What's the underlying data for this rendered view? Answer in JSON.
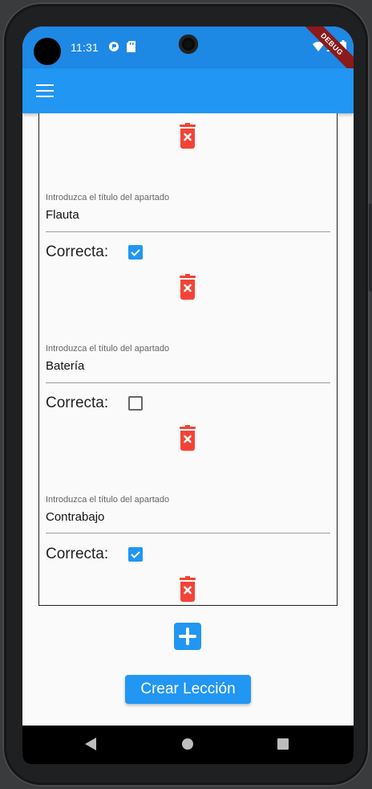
{
  "status_bar": {
    "time": "11:31",
    "icons": [
      "camera-hole",
      "p-badge-icon",
      "sd-card-icon",
      "wifi-icon",
      "signal-icon",
      "battery-icon"
    ],
    "debug_banner": "DEBUG"
  },
  "app_bar": {
    "menu_icon": "menu-icon"
  },
  "options": [
    {
      "label": "Introduzca el título del apartado",
      "value": "Flauta",
      "correct_label": "Correcta:",
      "correct": true
    },
    {
      "label": "Introduzca el título del apartado",
      "value": "Batería",
      "correct_label": "Correcta:",
      "correct": false
    },
    {
      "label": "Introduzca el título del apartado",
      "value": "Contrabajo",
      "correct_label": "Correcta:",
      "correct": true
    }
  ],
  "actions": {
    "add_icon": "plus-square-icon",
    "create_label": "Crear Lección"
  },
  "nav": [
    "back-icon",
    "home-icon",
    "recents-icon"
  ],
  "colors": {
    "primary": "#2196f3",
    "status": "#1e88e5",
    "delete": "#f44336"
  }
}
